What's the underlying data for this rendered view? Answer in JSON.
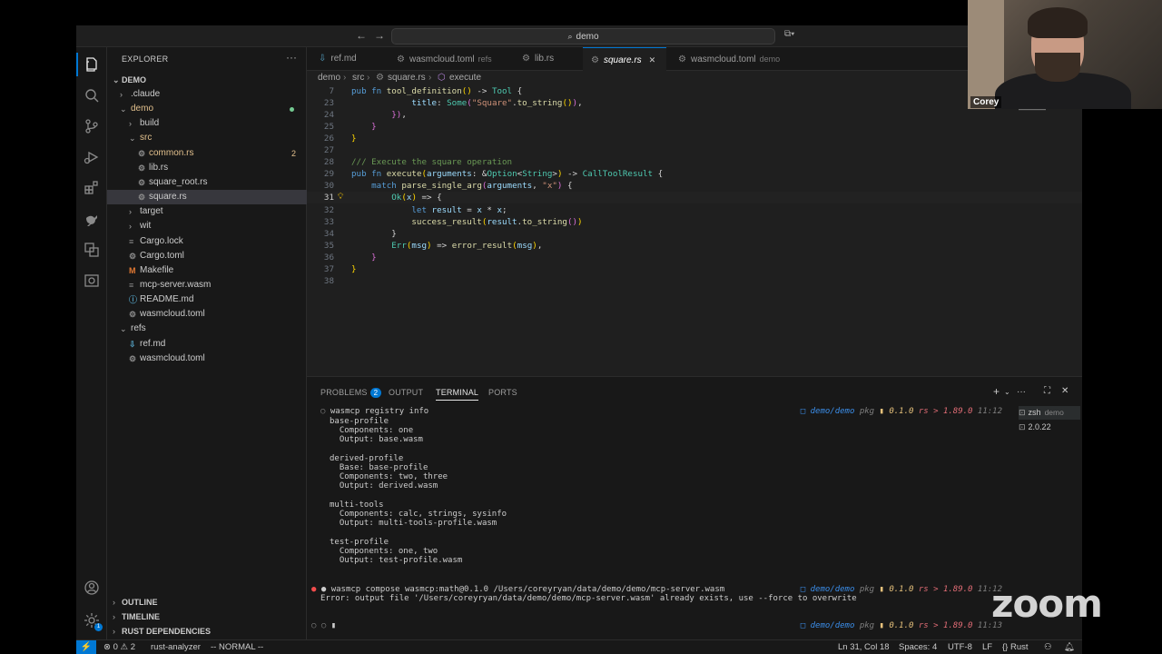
{
  "titlebar": {
    "search": "demo",
    "back": "←",
    "forward": "→"
  },
  "sidebar": {
    "title": "EXPLORER",
    "more": "···",
    "root": "DEMO",
    "tree": [
      {
        "label": ".claude",
        "kind": "folder",
        "depth": 1,
        "open": false
      },
      {
        "label": "demo",
        "kind": "folder",
        "depth": 1,
        "open": true,
        "color": "#e2c08d",
        "dot": true
      },
      {
        "label": "build",
        "kind": "folder",
        "depth": 2,
        "open": false
      },
      {
        "label": "src",
        "kind": "folder",
        "depth": 2,
        "open": true,
        "color": "#e2c08d"
      },
      {
        "label": "common.rs",
        "kind": "file",
        "depth": 3,
        "color": "#e2c08d",
        "badge": "2",
        "icon": "gear-icon"
      },
      {
        "label": "lib.rs",
        "kind": "file",
        "depth": 3,
        "icon": "gear-icon"
      },
      {
        "label": "square_root.rs",
        "kind": "file",
        "depth": 3,
        "icon": "gear-icon"
      },
      {
        "label": "square.rs",
        "kind": "file",
        "depth": 3,
        "icon": "gear-icon",
        "selected": true
      },
      {
        "label": "target",
        "kind": "folder",
        "depth": 2,
        "open": false
      },
      {
        "label": "wit",
        "kind": "folder",
        "depth": 2,
        "open": false
      },
      {
        "label": "Cargo.lock",
        "kind": "file",
        "depth": 2,
        "icon": "doc-icon"
      },
      {
        "label": "Cargo.toml",
        "kind": "file",
        "depth": 2,
        "icon": "gear-icon"
      },
      {
        "label": "Makefile",
        "kind": "file",
        "depth": 2,
        "icon": "makefile-icon"
      },
      {
        "label": "mcp-server.wasm",
        "kind": "file",
        "depth": 2,
        "icon": "doc-icon"
      },
      {
        "label": "README.md",
        "kind": "file",
        "depth": 2,
        "icon": "info-icon"
      },
      {
        "label": "wasmcloud.toml",
        "kind": "file",
        "depth": 2,
        "icon": "gear-icon"
      },
      {
        "label": "refs",
        "kind": "folder",
        "depth": 1,
        "open": true
      },
      {
        "label": "ref.md",
        "kind": "file",
        "depth": 2,
        "icon": "markdown-icon"
      },
      {
        "label": "wasmcloud.toml",
        "kind": "file",
        "depth": 2,
        "icon": "gear-icon"
      }
    ],
    "sections": [
      "OUTLINE",
      "TIMELINE",
      "RUST DEPENDENCIES"
    ]
  },
  "tabs": [
    {
      "label": "ref.md",
      "desc": "",
      "icon": "markdown-icon"
    },
    {
      "label": "wasmcloud.toml",
      "desc": "refs",
      "icon": "gear-icon"
    },
    {
      "label": "lib.rs",
      "desc": "",
      "icon": "gear-icon"
    },
    {
      "label": "square.rs",
      "desc": "",
      "icon": "gear-icon",
      "active": true,
      "close": "✕"
    },
    {
      "label": "wasmcloud.toml",
      "desc": "demo",
      "icon": "gear-icon"
    }
  ],
  "breadcrumb": [
    "demo",
    "src",
    "square.rs",
    "execute"
  ],
  "editor": {
    "lines": [
      {
        "n": "7",
        "tokens": [
          [
            "kw",
            "pub "
          ],
          [
            "kw",
            "fn "
          ],
          [
            "fn",
            "tool_definition"
          ],
          [
            "pn",
            "()"
          ],
          [
            "pl",
            " -> "
          ],
          [
            "ty",
            "Tool"
          ],
          [
            "pl",
            " {"
          ]
        ]
      },
      {
        "n": "23",
        "tokens": [
          [
            "pl",
            "            "
          ],
          [
            "var",
            "title"
          ],
          [
            "pl",
            ": "
          ],
          [
            "ty",
            "Some"
          ],
          [
            "pn2",
            "("
          ],
          [
            "str",
            "\"Square\""
          ],
          [
            "pl",
            "."
          ],
          [
            "fn",
            "to_string"
          ],
          [
            "pn",
            "()"
          ],
          [
            "pn2",
            ")"
          ],
          [
            "pl",
            ","
          ]
        ]
      },
      {
        "n": "24",
        "tokens": [
          [
            "pl",
            "        "
          ],
          [
            "pn2",
            "})"
          ],
          [
            "pl",
            ","
          ]
        ]
      },
      {
        "n": "25",
        "tokens": [
          [
            "pl",
            "    "
          ],
          [
            "pn2",
            "}"
          ]
        ]
      },
      {
        "n": "26",
        "tokens": [
          [
            "pn",
            "}"
          ]
        ]
      },
      {
        "n": "27",
        "tokens": []
      },
      {
        "n": "28",
        "tokens": [
          [
            "cm",
            "/// Execute the square operation"
          ]
        ]
      },
      {
        "n": "29",
        "tokens": [
          [
            "kw",
            "pub "
          ],
          [
            "kw",
            "fn "
          ],
          [
            "fn",
            "execute"
          ],
          [
            "pn",
            "("
          ],
          [
            "var",
            "arguments"
          ],
          [
            "pl",
            ": &"
          ],
          [
            "ty",
            "Option"
          ],
          [
            "pl",
            "<"
          ],
          [
            "ty",
            "String"
          ],
          [
            "pl",
            ">"
          ],
          [
            "pn",
            ")"
          ],
          [
            "pl",
            " -> "
          ],
          [
            "ty",
            "CallToolResult"
          ],
          [
            "pl",
            " {"
          ]
        ]
      },
      {
        "n": "30",
        "tokens": [
          [
            "pl",
            "    "
          ],
          [
            "kw",
            "match "
          ],
          [
            "fn",
            "parse_single_arg"
          ],
          [
            "pn2",
            "("
          ],
          [
            "var",
            "arguments"
          ],
          [
            "pl",
            ", "
          ],
          [
            "str",
            "\"x\""
          ],
          [
            "pn2",
            ")"
          ],
          [
            "pl",
            " {"
          ]
        ]
      },
      {
        "n": "31",
        "tokens": [
          [
            "pl",
            "        "
          ],
          [
            "ty",
            "Ok"
          ],
          [
            "pn",
            "("
          ],
          [
            "var",
            "x"
          ],
          [
            "pn",
            ")"
          ],
          [
            "pl",
            " => {"
          ]
        ],
        "current": true
      },
      {
        "n": "32",
        "tokens": [
          [
            "pl",
            "            "
          ],
          [
            "kw",
            "let "
          ],
          [
            "var",
            "result"
          ],
          [
            "pl",
            " = "
          ],
          [
            "var",
            "x"
          ],
          [
            "pl",
            " * "
          ],
          [
            "var",
            "x"
          ],
          [
            "pl",
            ";"
          ]
        ]
      },
      {
        "n": "33",
        "tokens": [
          [
            "pl",
            "            "
          ],
          [
            "fn",
            "success_result"
          ],
          [
            "pn",
            "("
          ],
          [
            "var",
            "result"
          ],
          [
            "pl",
            "."
          ],
          [
            "fn",
            "to_string"
          ],
          [
            "pn2",
            "()"
          ],
          [
            "pn",
            ")"
          ]
        ]
      },
      {
        "n": "34",
        "tokens": [
          [
            "pl",
            "        }"
          ]
        ]
      },
      {
        "n": "35",
        "tokens": [
          [
            "pl",
            "        "
          ],
          [
            "ty",
            "Err"
          ],
          [
            "pn",
            "("
          ],
          [
            "var",
            "msg"
          ],
          [
            "pn",
            ")"
          ],
          [
            "pl",
            " => "
          ],
          [
            "fn",
            "error_result"
          ],
          [
            "pn",
            "("
          ],
          [
            "var",
            "msg"
          ],
          [
            "pn",
            ")"
          ],
          [
            "pl",
            ","
          ]
        ]
      },
      {
        "n": "36",
        "tokens": [
          [
            "pl",
            "    "
          ],
          [
            "pn2",
            "}"
          ]
        ]
      },
      {
        "n": "37",
        "tokens": [
          [
            "pn",
            "}"
          ]
        ]
      },
      {
        "n": "38",
        "tokens": []
      }
    ]
  },
  "panel": {
    "tabs": [
      "PROBLEMS",
      "OUTPUT",
      "TERMINAL",
      "PORTS"
    ],
    "problems_count": "2",
    "active_tab": "TERMINAL",
    "terminals": [
      {
        "label": "zsh",
        "desc": "demo"
      },
      {
        "label": "2.0.22",
        "desc": ""
      }
    ],
    "prompt_right": {
      "path": "demo/demo",
      "pkg": "pkg",
      "version": "0.1.0",
      "rs": "rs",
      "rust_version": "1.89.0"
    },
    "cmd1": "wasmcp registry info",
    "time1": "11:12",
    "output": [
      "base-profile",
      "  Components: one",
      "  Output: base.wasm",
      "",
      "derived-profile",
      "  Base: base-profile",
      "  Components: two, three",
      "  Output: derived.wasm",
      "",
      "multi-tools",
      "  Components: calc, strings, sysinfo",
      "  Output: multi-tools-profile.wasm",
      "",
      "test-profile",
      "  Components: one, two",
      "  Output: test-profile.wasm"
    ],
    "cmd2": "wasmcp compose wasmcp:math@0.1.0 /Users/coreyryan/data/demo/demo/mcp-server.wasm",
    "time2": "11:12",
    "error": "Error: output file '/Users/coreyryan/data/demo/demo/mcp-server.wasm' already exists, use --force to overwrite",
    "time3": "11:13"
  },
  "statusbar": {
    "errors": "0",
    "warnings": "2",
    "lsp": "rust-analyzer",
    "mode": "-- NORMAL --",
    "position": "Ln 31, Col 18",
    "spaces": "Spaces: 4",
    "encoding": "UTF-8",
    "eol": "LF",
    "language": "Rust"
  },
  "video": {
    "name": "Corey",
    "watermark": "zoom"
  },
  "colors": {
    "accent": "#0078d4",
    "modified": "#e2c08d",
    "error": "#f14c4c"
  }
}
